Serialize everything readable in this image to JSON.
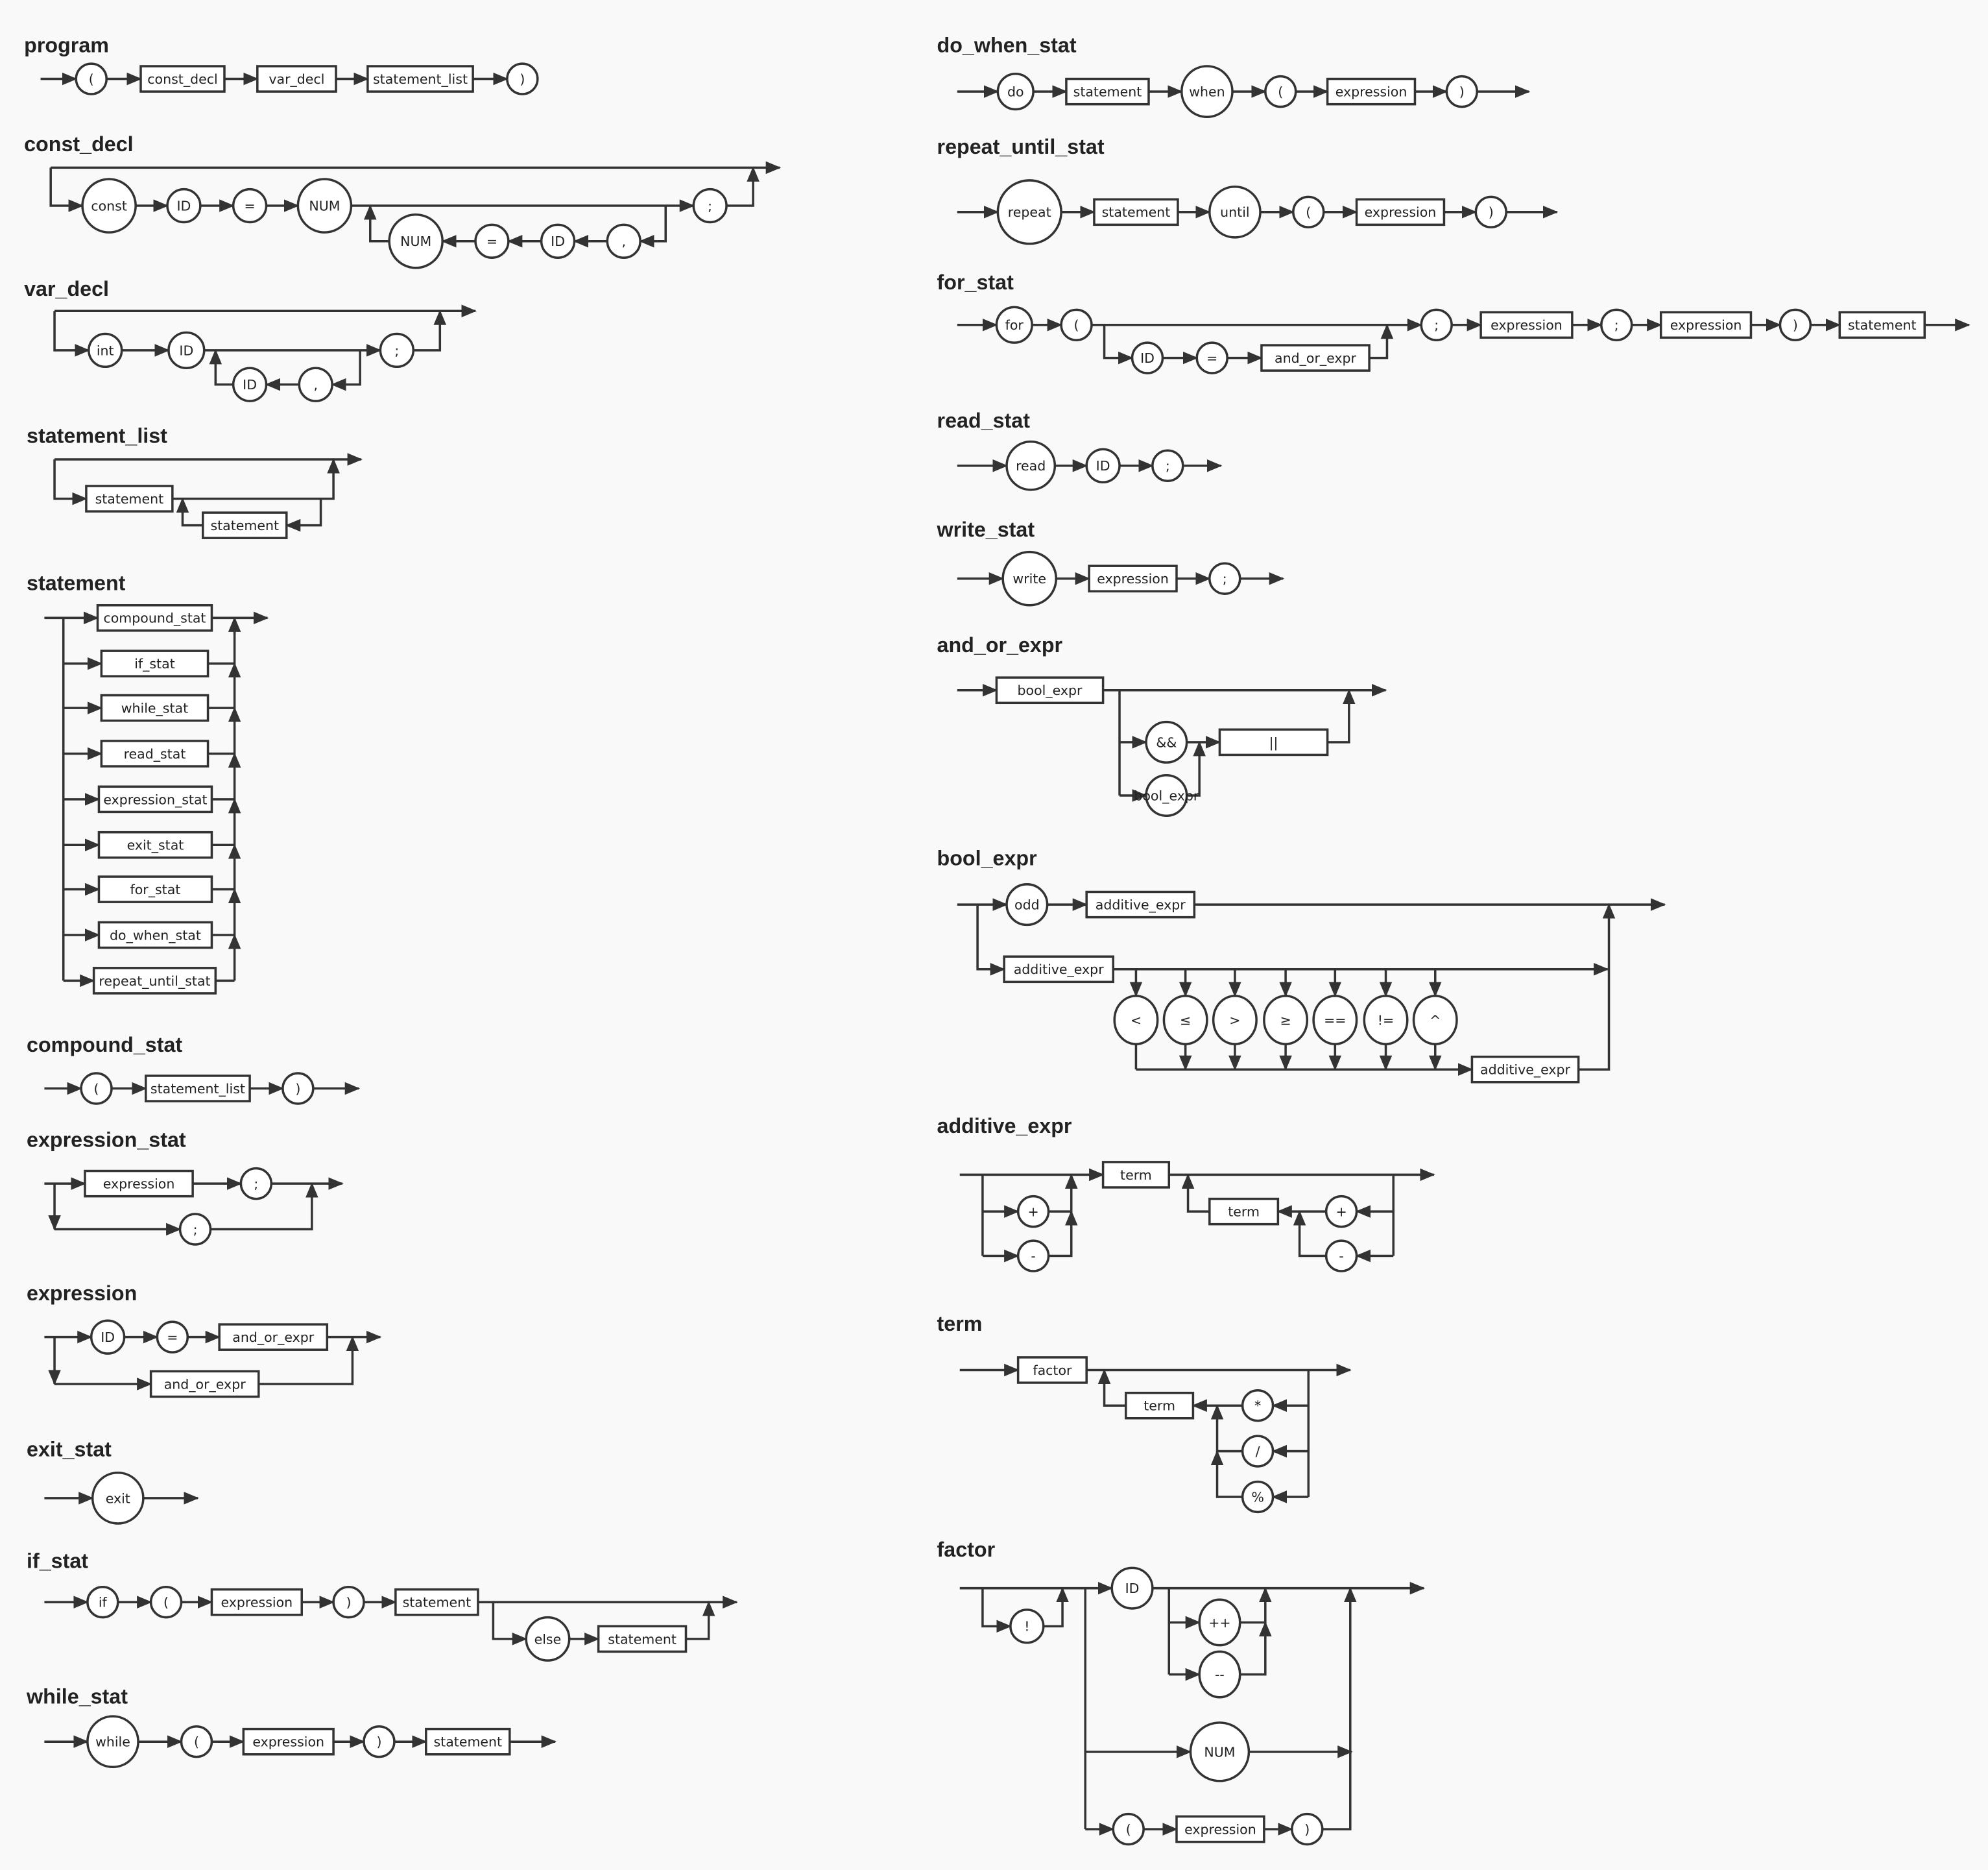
{
  "diagrams": {
    "program": {
      "title": "program",
      "nodes": [
        "(",
        "const_decl",
        "var_decl",
        "statement_list",
        ")"
      ]
    },
    "const_decl": {
      "title": "const_decl",
      "nodes": [
        "const",
        "ID",
        "=",
        "NUM",
        ";",
        ",",
        "ID",
        "=",
        "NUM"
      ]
    },
    "var_decl": {
      "title": "var_decl",
      "nodes": [
        "int",
        "ID",
        ";",
        ",",
        "ID"
      ]
    },
    "statement_list": {
      "title": "statement_list",
      "nodes": [
        "statement",
        "statement"
      ]
    },
    "statement": {
      "title": "statement",
      "nodes": [
        "compound_stat",
        "if_stat",
        "while_stat",
        "read_stat",
        "expression_stat",
        "exit_stat",
        "for_stat",
        "do_when_stat",
        "repeat_until_stat"
      ]
    },
    "compound_stat": {
      "title": "compound_stat",
      "nodes": [
        "(",
        "statement_list",
        ")"
      ]
    },
    "expression_stat": {
      "title": "expression_stat",
      "nodes": [
        "expression",
        ";",
        ";"
      ]
    },
    "expression": {
      "title": "expression",
      "nodes": [
        "ID",
        "=",
        "and_or_expr",
        "and_or_expr"
      ]
    },
    "exit_stat": {
      "title": "exit_stat",
      "nodes": [
        "exit"
      ]
    },
    "if_stat": {
      "title": "if_stat",
      "nodes": [
        "if",
        "(",
        "expression",
        ")",
        "statement",
        "else",
        "statement"
      ]
    },
    "while_stat": {
      "title": "while_stat",
      "nodes": [
        "while",
        "(",
        "expression",
        ")",
        "statement"
      ]
    },
    "do_when_stat": {
      "title": "do_when_stat",
      "nodes": [
        "do",
        "statement",
        "when",
        "(",
        "expression",
        ")"
      ]
    },
    "repeat_until_stat": {
      "title": "repeat_until_stat",
      "nodes": [
        "repeat",
        "statement",
        "until",
        "(",
        "expression",
        ")"
      ]
    },
    "for_stat": {
      "title": "for_stat",
      "nodes": [
        "for",
        "(",
        ";",
        "expression",
        ";",
        "expression",
        ")",
        "statement",
        "ID",
        "=",
        "and_or_expr"
      ]
    },
    "read_stat": {
      "title": "read_stat",
      "nodes": [
        "read",
        "ID",
        ";"
      ]
    },
    "write_stat": {
      "title": "write_stat",
      "nodes": [
        "write",
        "expression",
        ";"
      ]
    },
    "and_or_expr": {
      "title": "and_or_expr",
      "nodes": [
        "bool_expr",
        "&&",
        "||",
        "bool_expr"
      ]
    },
    "bool_expr": {
      "title": "bool_expr",
      "nodes": [
        "odd",
        "additive_expr",
        "additive_expr",
        "<",
        "≤",
        ">",
        "≥",
        "==",
        "!=",
        "^",
        "additive_expr"
      ]
    },
    "additive_expr": {
      "title": "additive_expr",
      "nodes": [
        "term",
        "+",
        "-",
        "+",
        "-",
        "term"
      ]
    },
    "term": {
      "title": "term",
      "nodes": [
        "factor",
        "*",
        "/",
        "%",
        "term"
      ]
    },
    "factor": {
      "title": "factor",
      "nodes": [
        "ID",
        "!",
        "++",
        "--",
        "NUM",
        "(",
        "expression",
        ")"
      ]
    }
  }
}
